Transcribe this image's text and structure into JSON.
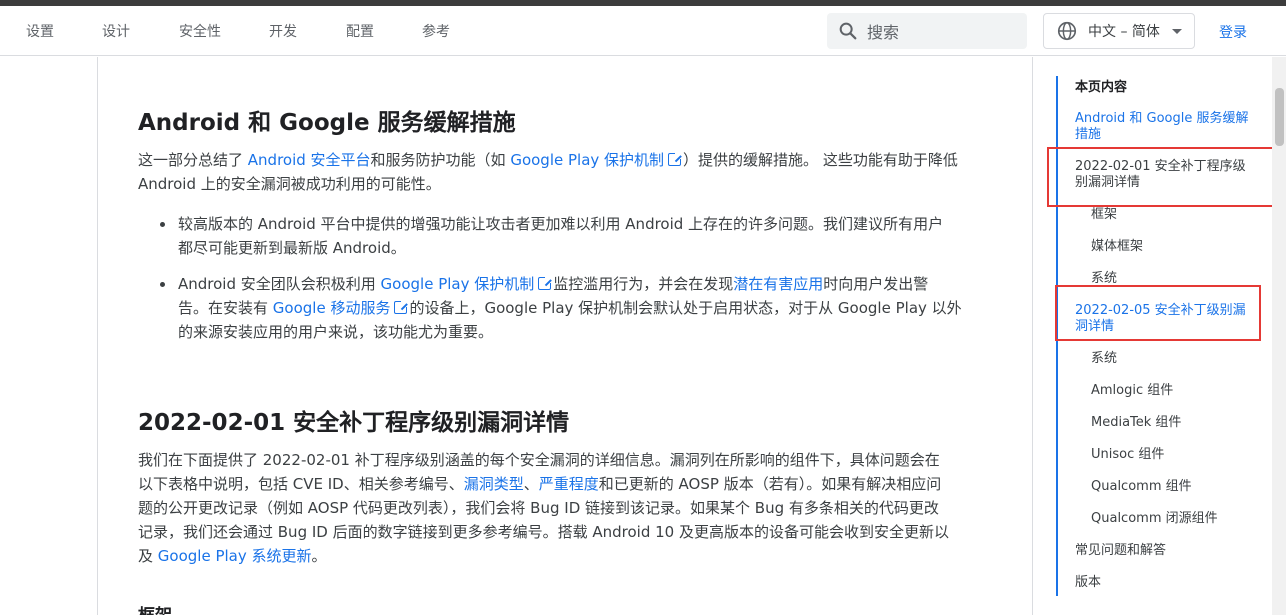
{
  "nav": [
    "设置",
    "设计",
    "安全性",
    "开发",
    "配置",
    "参考"
  ],
  "search": {
    "placeholder": "搜索"
  },
  "language": {
    "label": "中文 – 简体"
  },
  "login": "登录",
  "section1": {
    "title": "Android 和 Google 服务缓解措施",
    "intro_1": "这一部分总结了 ",
    "link_platform": "Android 安全平台",
    "intro_2": "和服务防护功能（如 ",
    "link_gpp": "Google Play 保护机制",
    "intro_3": "）提供的缓解措施。 这些功能有助于降低",
    "intro_4": "Android 上的安全漏洞被成功利用的可能性。",
    "bullet1_line1": "较高版本的 Android 平台中提供的增强功能让攻击者更加难以利用 Android 上存在的许多问题。我们建议所有用户",
    "bullet1_line2": "都尽可能更新到最新版 Android。",
    "bullet2_a": "Android 安全团队会积极利用 ",
    "bullet2_link1": "Google Play 保护机制",
    "bullet2_b": "监控滥用行为，并会在发现",
    "bullet2_link2": "潜在有害应用",
    "bullet2_c": "时向用户发出警",
    "bullet2_d": "告。在安装有 ",
    "bullet2_link3": "Google 移动服务",
    "bullet2_e": "的设备上，Google Play 保护机制会默认处于启用状态，对于从 Google Play 以外",
    "bullet2_f": "的来源安装应用的用户来说，该功能尤为重要。"
  },
  "section2": {
    "title": "2022-02-01 安全补丁程序级别漏洞详情",
    "l1": "我们在下面提供了 2022-02-01 补丁程序级别涵盖的每个安全漏洞的详细信息。漏洞列在所影响的组件下，具体问题会在",
    "l2a": "以下表格中说明，包括 CVE ID、相关参考编号、",
    "l2_link1": "漏洞类型",
    "l2b": "、",
    "l2_link2": "严重程度",
    "l2c": "和已更新的 AOSP 版本（若有）。如果有解决相应问",
    "l3": "题的公开更改记录（例如 AOSP 代码更改列表），我们会将 Bug ID 链接到该记录。如果某个 Bug 有多条相关的代码更改",
    "l4": "记录，我们还会通过 Bug ID 后面的数字链接到更多参考编号。搭载 Android 10 及更高版本的设备可能会收到安全更新以",
    "l5a": "及 ",
    "l5_link": "Google Play 系统更新",
    "l5b": "。",
    "sub": "框架"
  },
  "toc": {
    "heading": "本页内容",
    "item1": "Android 和 Google 服务缓解措施",
    "item2": "2022-02-01 安全补丁程序级别漏洞详情",
    "item2_subs": [
      "框架",
      "媒体框架",
      "系统"
    ],
    "item3": "2022-02-05 安全补丁级别漏洞详情",
    "item3_subs": [
      "系统",
      "Amlogic 组件",
      "MediaTek 组件",
      "Unisoc 组件",
      "Qualcomm 组件",
      "Qualcomm 闭源组件"
    ],
    "item4": "常见问题和解答",
    "item5": "版本"
  },
  "colors": {
    "link": "#1a73e8",
    "highlight": "#e53935"
  }
}
